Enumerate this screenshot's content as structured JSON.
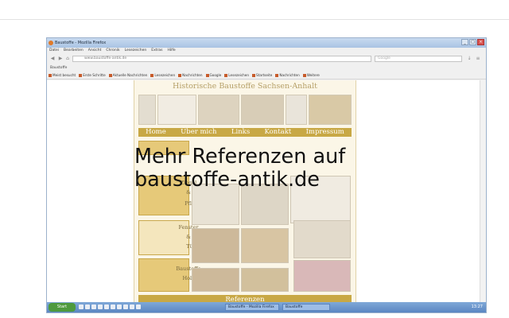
{
  "browser": {
    "window_title": "Baustoffe - Mozilla Firefox",
    "menu": [
      "Datei",
      "Bearbeiten",
      "Ansicht",
      "Chronik",
      "Lesezeichen",
      "Extras",
      "Hilfe"
    ],
    "url": "www.baustoffe-antik.de",
    "search_placeholder": "Google",
    "tab_label": "Baustoffe",
    "bookmarks": [
      "Meist besucht",
      "Erste Schritte",
      "Aktuelle Nachrichten",
      "Lesezeichen",
      "Nachrichten",
      "Google",
      "Lesezeichen",
      "Startseite",
      "Nachrichten",
      "Weitere"
    ]
  },
  "website": {
    "title": "Historische Baustoffe Sachsen-Anhalt",
    "nav": [
      "Home",
      "Über mich",
      "Links",
      "Kontakt",
      "Impressum"
    ],
    "sidebar": {
      "ziegel": [
        "Ziegel",
        "&",
        "Pflaster"
      ],
      "fenster": [
        "Fenster",
        "&",
        "Türen"
      ],
      "holz": [
        "Baustoffe",
        "Holz"
      ]
    },
    "footer": "Referenzen"
  },
  "overlay": {
    "line1": "Mehr Referenzen auf",
    "line2": "baustoffe-antik.de"
  },
  "taskbar": {
    "start_label": "Start",
    "tasks": [
      "Baustoffe - Mozilla Firefox",
      "Baustoffe"
    ],
    "clock": "13:27"
  },
  "colors": {
    "accent_gold": "#c8a845",
    "page_bg": "#fbf6e7",
    "taskbar_blue": "#5b86c2"
  }
}
